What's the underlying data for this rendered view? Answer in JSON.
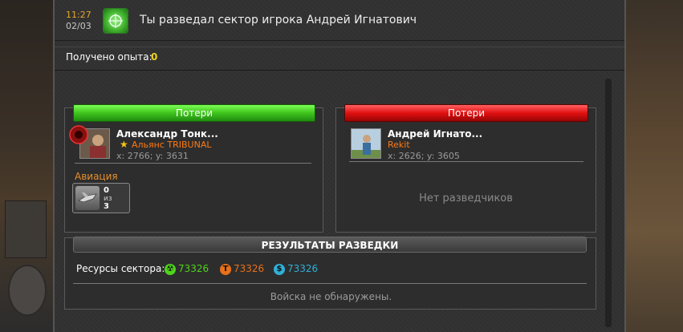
{
  "header": {
    "time": "11:27",
    "date": "02/03",
    "title": "Ты разведал сектор игрока Андрей Игнатович",
    "icon": "radar-icon"
  },
  "experience": {
    "label": "Получено опыта:",
    "value": "0"
  },
  "attacker": {
    "header": "Потери",
    "name": "Александр Тонк...",
    "alliance": "Альянс TRIBUNAL",
    "coords": "x: 2766; y: 3631",
    "category": "Авиация",
    "unit": {
      "count": "0",
      "of": "из",
      "total": "3"
    }
  },
  "defender": {
    "header": "Потери",
    "name": "Андрей Игнато...",
    "alliance": "Rekit",
    "coords": "x: 2626; y: 3605",
    "no_scouts": "Нет разведчиков"
  },
  "results": {
    "header": "РЕЗУЛЬТАТЫ РАЗВЕДКИ",
    "resources_label": "Ресурсы сектора:",
    "resources": [
      {
        "value": "73326",
        "color": "#4fd31c",
        "icon": "radiation-icon"
      },
      {
        "value": "73326",
        "color": "#e8701a",
        "icon": "titanium-icon"
      },
      {
        "value": "73326",
        "color": "#2fb0d8",
        "icon": "money-icon"
      }
    ],
    "no_troops": "Войска не обнаружены."
  },
  "colors": {
    "green": "#3fc41d",
    "red": "#e01010",
    "accent": "#f2d21a"
  }
}
